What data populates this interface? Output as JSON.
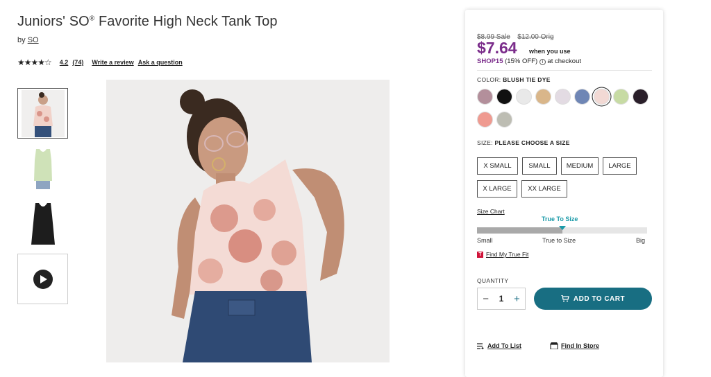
{
  "product": {
    "title": "Juniors' SO",
    "title_mark": "®",
    "title_rest": " Favorite High Neck Tank Top",
    "by_label": "by",
    "brand": "SO",
    "stars": "★★★★☆",
    "rating_value": "4.2",
    "review_count": "(74)",
    "write_review": "Write a review",
    "ask_question": "Ask a question"
  },
  "pricing": {
    "sale_price_old": "$8.99 Sale",
    "orig_price": "$12.00 Orig",
    "price": "$7.64",
    "when_use": "when you use",
    "promo_code": "SHOP15",
    "promo_detail": " (15% OFF)",
    "at_checkout": " at checkout"
  },
  "color": {
    "label": "COLOR:",
    "selected": "BLUSH TIE DYE",
    "swatches": [
      "#b38f9b",
      "#111111",
      "#e9e9e9",
      "#d9b68a",
      "#e3dbe3",
      "#6f86b5",
      "#f2d9d4",
      "#c7dba4",
      "#2a1f2a",
      "#ef9a90",
      "#bdbdb3"
    ]
  },
  "size": {
    "label": "SIZE:",
    "prompt": "PLEASE CHOOSE A SIZE",
    "options": [
      "X SMALL",
      "SMALL",
      "MEDIUM",
      "LARGE",
      "X LARGE",
      "XX LARGE"
    ],
    "size_chart": "Size Chart",
    "fit_label": "True To Size",
    "fit_fraction": 0.5,
    "scale_small": "Small",
    "scale_mid": "True to Size",
    "scale_big": "Big",
    "true_fit_badge": "T",
    "true_fit_link": "Find My True Fit"
  },
  "purchase": {
    "qty_label": "QUANTITY",
    "qty_value": "1",
    "minus": "−",
    "plus": "+",
    "add_to_cart": "ADD TO CART",
    "add_to_list": "Add To List",
    "find_in_store": "Find In Store"
  },
  "colors": {
    "accent_purple": "#7b2d8b",
    "cart_teal": "#186e82",
    "fit_teal": "#1a9aa8"
  }
}
